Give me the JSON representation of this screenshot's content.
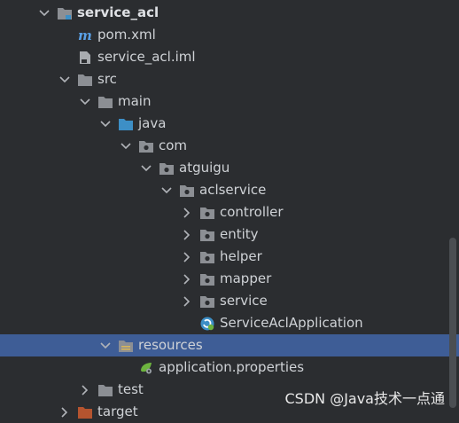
{
  "tree": [
    {
      "label": "service_acl",
      "depth": 0,
      "chevron": "down",
      "icon": "module-folder-icon",
      "bold": true,
      "selected": false
    },
    {
      "label": "pom.xml",
      "depth": 1,
      "chevron": "none",
      "icon": "maven-icon",
      "bold": false,
      "selected": false
    },
    {
      "label": "service_acl.iml",
      "depth": 1,
      "chevron": "none",
      "icon": "iml-file-icon",
      "bold": false,
      "selected": false
    },
    {
      "label": "src",
      "depth": 1,
      "chevron": "down",
      "icon": "folder-icon",
      "bold": false,
      "selected": false
    },
    {
      "label": "main",
      "depth": 2,
      "chevron": "down",
      "icon": "folder-icon",
      "bold": false,
      "selected": false
    },
    {
      "label": "java",
      "depth": 3,
      "chevron": "down",
      "icon": "source-folder-icon",
      "bold": false,
      "selected": false
    },
    {
      "label": "com",
      "depth": 4,
      "chevron": "down",
      "icon": "package-icon",
      "bold": false,
      "selected": false
    },
    {
      "label": "atguigu",
      "depth": 5,
      "chevron": "down",
      "icon": "package-icon",
      "bold": false,
      "selected": false
    },
    {
      "label": "aclservice",
      "depth": 6,
      "chevron": "down",
      "icon": "package-icon",
      "bold": false,
      "selected": false
    },
    {
      "label": "controller",
      "depth": 7,
      "chevron": "right",
      "icon": "package-icon",
      "bold": false,
      "selected": false
    },
    {
      "label": "entity",
      "depth": 7,
      "chevron": "right",
      "icon": "package-icon",
      "bold": false,
      "selected": false
    },
    {
      "label": "helper",
      "depth": 7,
      "chevron": "right",
      "icon": "package-icon",
      "bold": false,
      "selected": false
    },
    {
      "label": "mapper",
      "depth": 7,
      "chevron": "right",
      "icon": "package-icon",
      "bold": false,
      "selected": false
    },
    {
      "label": "service",
      "depth": 7,
      "chevron": "right",
      "icon": "package-icon",
      "bold": false,
      "selected": false
    },
    {
      "label": "ServiceAclApplication",
      "depth": 7,
      "chevron": "none",
      "icon": "spring-boot-app-icon",
      "bold": false,
      "selected": false
    },
    {
      "label": "resources",
      "depth": 3,
      "chevron": "down",
      "icon": "resources-folder-icon",
      "bold": false,
      "selected": true
    },
    {
      "label": "application.properties",
      "depth": 4,
      "chevron": "none",
      "icon": "spring-properties-icon",
      "bold": false,
      "selected": false
    },
    {
      "label": "test",
      "depth": 2,
      "chevron": "right",
      "icon": "folder-icon",
      "bold": false,
      "selected": false
    },
    {
      "label": "target",
      "depth": 1,
      "chevron": "right",
      "icon": "excluded-folder-icon",
      "bold": false,
      "selected": false
    }
  ],
  "watermark": "CSDN @Java技术一点通",
  "colors": {
    "background": "#2b2d30",
    "selection": "#3e5d96",
    "folder": "#8c8f94",
    "source_folder": "#3d8fc6",
    "excluded_folder": "#b5542f",
    "spring": "#6db33f"
  }
}
